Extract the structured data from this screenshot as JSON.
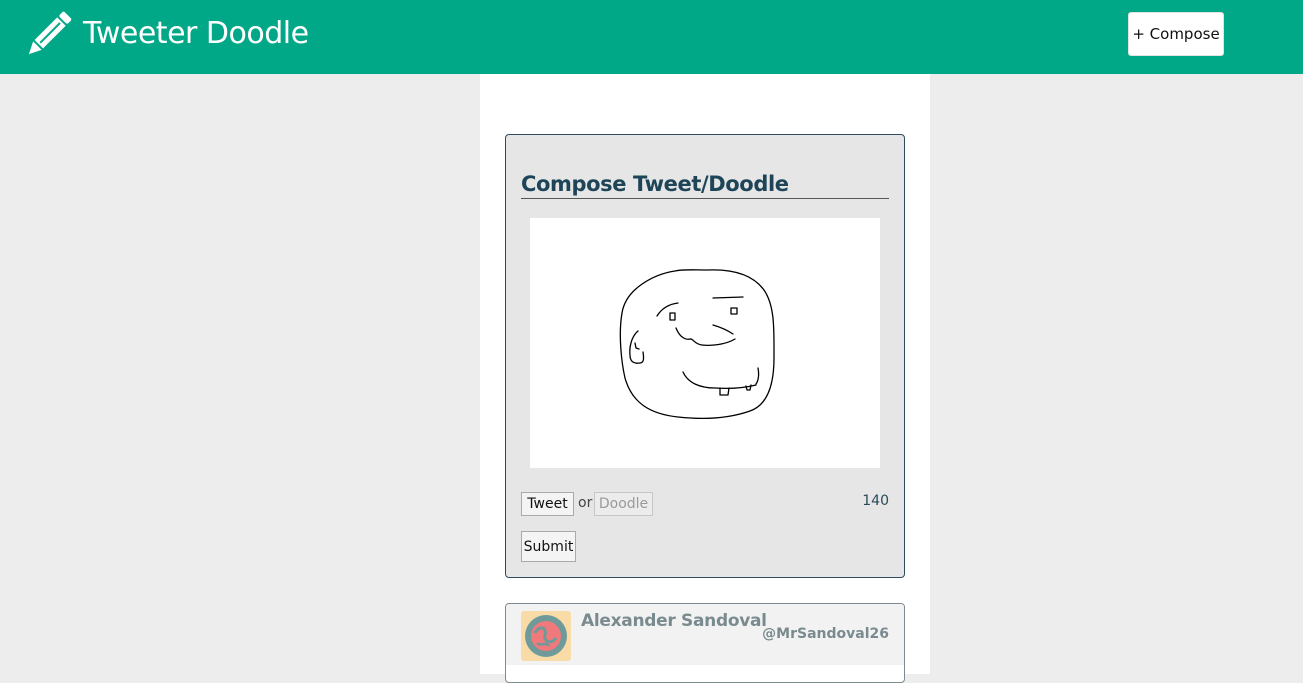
{
  "header": {
    "brand": "Tweeter Doodle",
    "compose_button": "+ Compose",
    "logo_icon": "pencil-icon",
    "background_color": "#00a887"
  },
  "compose": {
    "title": "Compose Tweet/Doodle",
    "modes": {
      "tweet": "Tweet",
      "separator": "or",
      "doodle": "Doodle",
      "selected": "Tweet"
    },
    "char_count": "140",
    "submit_label": "Submit"
  },
  "tweets": [
    {
      "name": "Alexander Sandoval",
      "handle": "@MrSandoval26",
      "avatar_icon": "avatar-icon"
    }
  ]
}
